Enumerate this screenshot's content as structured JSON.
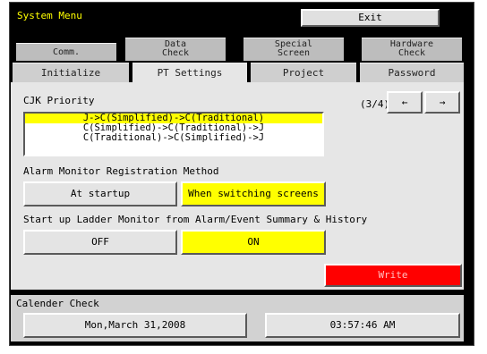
{
  "window": {
    "title": "System Menu",
    "exit_label": "Exit"
  },
  "tabs_row1": [
    {
      "line1": "Comm.",
      "line2": ""
    },
    {
      "line1": "Data",
      "line2": "Check"
    },
    {
      "line1": "Special",
      "line2": "Screen"
    },
    {
      "line1": "Hardware",
      "line2": "Check"
    }
  ],
  "tabs_row2": [
    {
      "label": "Initialize",
      "active": false
    },
    {
      "label": "PT Settings",
      "active": true
    },
    {
      "label": "Project",
      "active": false
    },
    {
      "label": "Password",
      "active": false
    }
  ],
  "cjk": {
    "label": "CJK Priority",
    "page": "(3/4)",
    "prev_label": "←",
    "next_label": "→",
    "options": [
      "J->C(Simplified)->C(Traditional)",
      "C(Simplified)->C(Traditional)->J",
      "C(Traditional)->C(Simplified)->J"
    ],
    "selected_index": 0
  },
  "alarm": {
    "label": "Alarm Monitor Registration Method",
    "options": [
      "At startup",
      "When switching screens"
    ],
    "selected_index": 1
  },
  "ladder": {
    "label": "Start up Ladder Monitor from Alarm/Event Summary & History",
    "options": [
      "OFF",
      "ON"
    ],
    "selected_index": 1
  },
  "write_label": "Write",
  "calendar": {
    "label": "Calender Check",
    "date": "Mon,March 31,2008",
    "time": "03:57:46 AM"
  },
  "colors": {
    "selected": "#ffff00",
    "write": "#ff0000",
    "title": "#ffff00"
  }
}
